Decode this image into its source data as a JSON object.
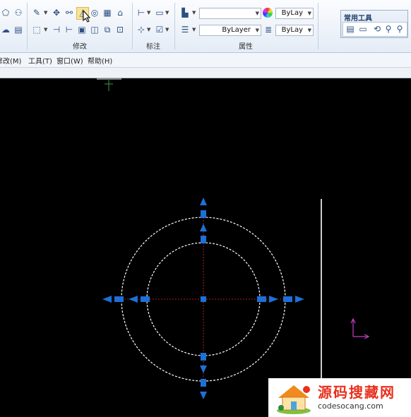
{
  "ribbon": {
    "groups": [
      {
        "label": "修改"
      },
      {
        "label": "标注"
      },
      {
        "label": "属性"
      }
    ],
    "properties": {
      "layer_combo_top": "",
      "color_combo": "ByLay",
      "linetype_combo": "ByLayer",
      "lineweight_combo": "ByLay"
    },
    "palette": {
      "title": "常用工具"
    }
  },
  "menubar": {
    "items": [
      "修改(M)",
      "工具(T)",
      "窗口(W)",
      "帮助(H)"
    ]
  },
  "watermark": {
    "title": "源码搜藏网",
    "url": "codesocang.com"
  },
  "colors": {
    "canvas_bg": "#000000",
    "grip_blue": "#1e6fd6",
    "dash_white": "#ffffff",
    "center_red": "#b02020",
    "ucs_magenta": "#c040c0",
    "brand_red": "#e8301d"
  }
}
